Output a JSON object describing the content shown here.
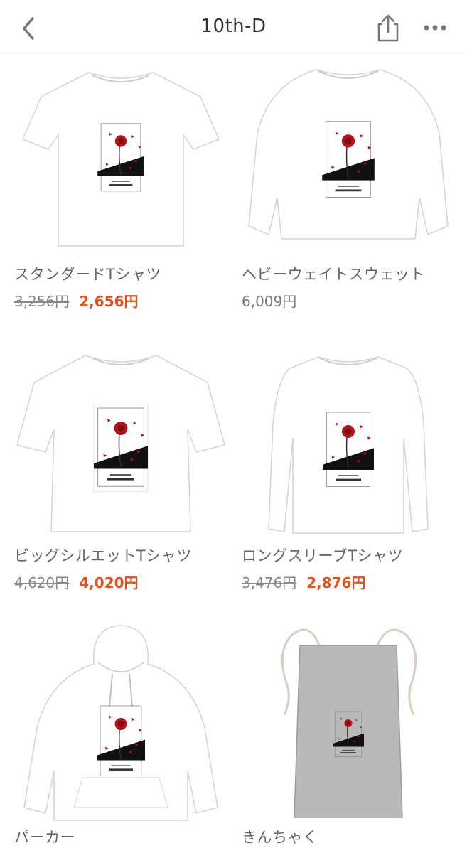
{
  "nav": {
    "title": "10th-D"
  },
  "products": [
    {
      "name": "スタンダードTシャツ",
      "old_price": "3,256円",
      "price": "2,656円",
      "type": "tshirt",
      "color": "#ffffff"
    },
    {
      "name": "ヘビーウェイトスウェット",
      "old_price": "",
      "price": "6,009円",
      "type": "sweat",
      "color": "#ffffff"
    },
    {
      "name": "ビッグシルエットTシャツ",
      "old_price": "4,620円",
      "price": "4,020円",
      "type": "bigtee",
      "color": "#ffffff"
    },
    {
      "name": "ロングスリーブTシャツ",
      "old_price": "3,476円",
      "price": "2,876円",
      "type": "longsleeve",
      "color": "#ffffff"
    },
    {
      "name": "パーカー",
      "old_price": "",
      "price": "",
      "type": "hoodie",
      "color": "#ffffff"
    },
    {
      "name": "きんちゃく",
      "old_price": "",
      "price": "",
      "type": "bag",
      "color": "#b9b9b9"
    }
  ],
  "colors": {
    "sale": "#e0511b",
    "flower": "#b3141b"
  }
}
